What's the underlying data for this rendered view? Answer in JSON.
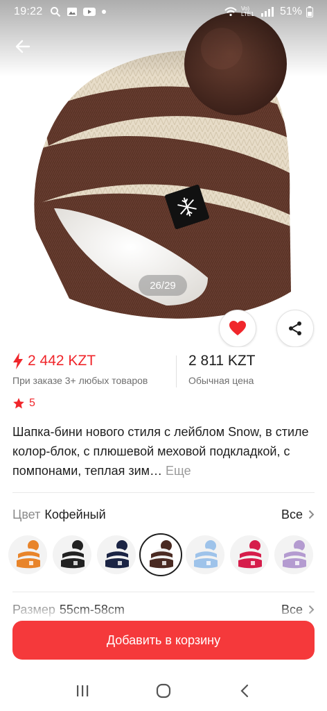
{
  "status_bar": {
    "time": "19:22",
    "network_label": "Vo) LTE1",
    "battery": "51%"
  },
  "gallery": {
    "counter": "26/29"
  },
  "price": {
    "discount_price": "2 442 KZT",
    "discount_note": "При заказе 3+ любых товаров",
    "regular_price": "2 811 KZT",
    "regular_note": "Обычная цена"
  },
  "rating": {
    "value": "5"
  },
  "product": {
    "title": "Шапка-бини нового стиля с лейблом Snow, в стиле колор-блок, с плюшевой меховой подкладкой, с помпонами, теплая зим…",
    "more_label": "Еще"
  },
  "color_selector": {
    "label": "Цвет",
    "selected_value": "Кофейный",
    "all_label": "Все",
    "swatches": [
      {
        "name": "orange",
        "color": "#e8842a"
      },
      {
        "name": "black",
        "color": "#222222"
      },
      {
        "name": "navy",
        "color": "#1b2444"
      },
      {
        "name": "coffee",
        "color": "#4a2a22"
      },
      {
        "name": "light-blue",
        "color": "#9ec3ea"
      },
      {
        "name": "crimson",
        "color": "#d61d4b"
      },
      {
        "name": "lavender",
        "color": "#b49bd0"
      }
    ]
  },
  "size_selector": {
    "label": "Размер",
    "selected_value": "55cm-58cm",
    "all_label": "Все"
  },
  "actions": {
    "add_to_cart": "Добавить в корзину"
  },
  "colors": {
    "accent": "#f0262b",
    "button": "#f5393b"
  }
}
